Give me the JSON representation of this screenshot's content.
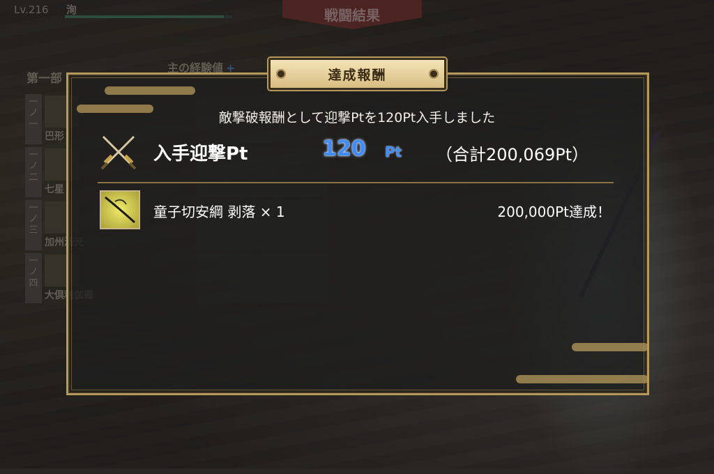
{
  "player": {
    "level": "Lv.216",
    "name": "洵"
  },
  "banner": {
    "title": "戦闘結果"
  },
  "background_panel": {
    "party_title": "第一部",
    "exp_title": "主の経験値",
    "members": [
      {
        "number": "一ノ一",
        "name": "巴形"
      },
      {
        "number": "一ノ二",
        "name": "七星"
      },
      {
        "number": "一ノ三",
        "name": "加州清光"
      },
      {
        "number": "一ノ四",
        "name": "大倶利伽羅"
      }
    ]
  },
  "dialog": {
    "title": "達成報酬",
    "message": "敵撃破報酬として迎撃Ptを120Pt入手しました",
    "points": {
      "label": "入手迎撃Pt",
      "value": "120",
      "unit": "Pt",
      "total": "（合計200,069Pt）"
    },
    "reward": {
      "item": "童子切安綱 剥落 × 1",
      "achievement": "200,000Pt達成！"
    }
  },
  "colors": {
    "frame": "#b59a5b",
    "points_blue": "#3f8cff",
    "plate": "#e8d49f"
  },
  "icons": {
    "swords": "crossed-swords-icon",
    "item": "sword-item-icon",
    "plus": "plus-icon"
  }
}
